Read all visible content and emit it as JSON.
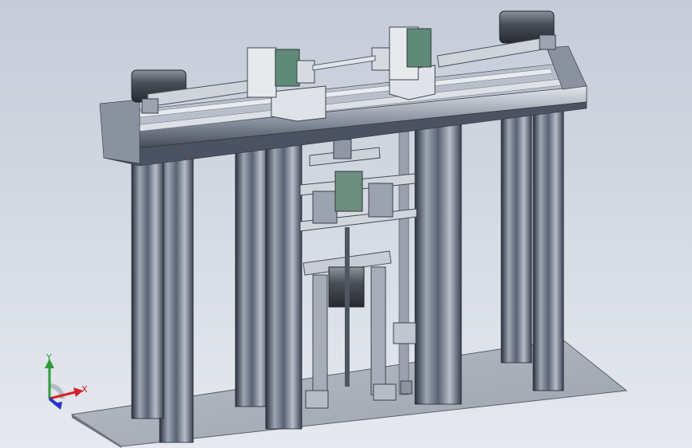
{
  "triad": {
    "x_label": "X",
    "y_label": "Y",
    "x_color": "#d4202a",
    "y_color": "#2f9b3a",
    "z_color": "#2536c9"
  },
  "colors": {
    "background_top": "#c5cbd8",
    "background_bottom": "#e6e9ef",
    "frame_dark": "#2b3240",
    "frame_mid": "#7f8898",
    "frame_light": "#c9ced8",
    "base_plate": "#aab0bb",
    "motor_body": "#3e434c",
    "bracket_green": "#5f8a7a"
  }
}
